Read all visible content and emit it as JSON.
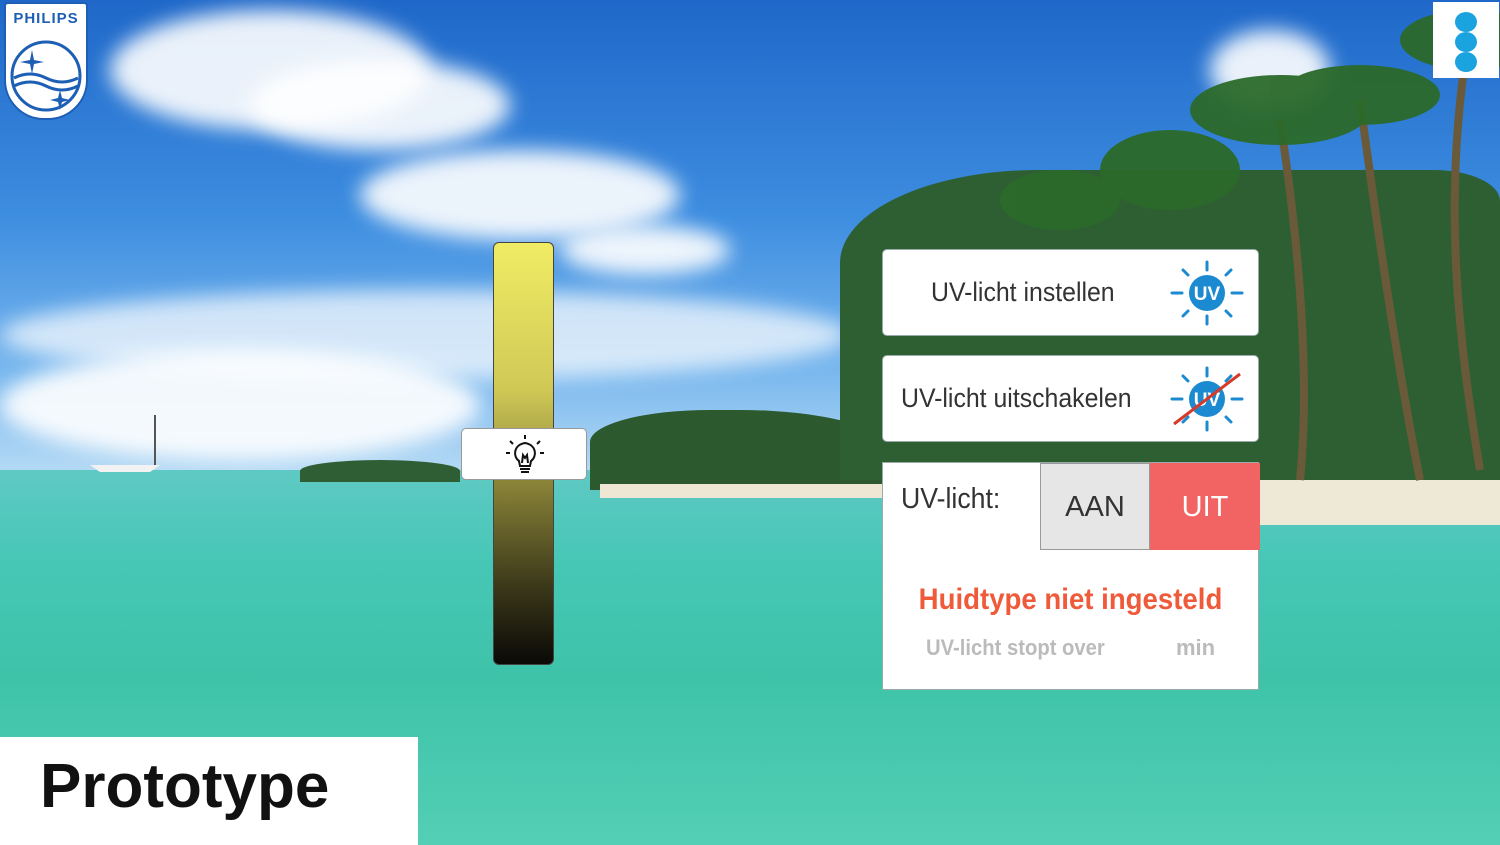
{
  "brand": {
    "logo_text": "PHILIPS",
    "primary_color": "#1c5fb5"
  },
  "menu": {
    "icon": "kebab-menu-icon",
    "color": "#1aa3df"
  },
  "brightness_slider": {
    "icon": "lightbulb-icon",
    "level": 0.5
  },
  "buttons": {
    "set_uv": {
      "label": "UV-licht instellen",
      "icon": "uv-sun-icon"
    },
    "disable_uv": {
      "label": "UV-licht uitschakelen",
      "icon": "uv-sun-crossed-icon"
    }
  },
  "uv_status": {
    "label": "UV-licht:",
    "on_label": "AAN",
    "off_label": "UIT",
    "selected": "UIT",
    "off_color": "#f26363",
    "message": "Huidtype niet ingesteld",
    "message_color": "#ef5b3a",
    "timer_prefix": "UV-licht stopt over",
    "timer_unit": "min"
  },
  "watermark": {
    "text": "Prototype"
  }
}
